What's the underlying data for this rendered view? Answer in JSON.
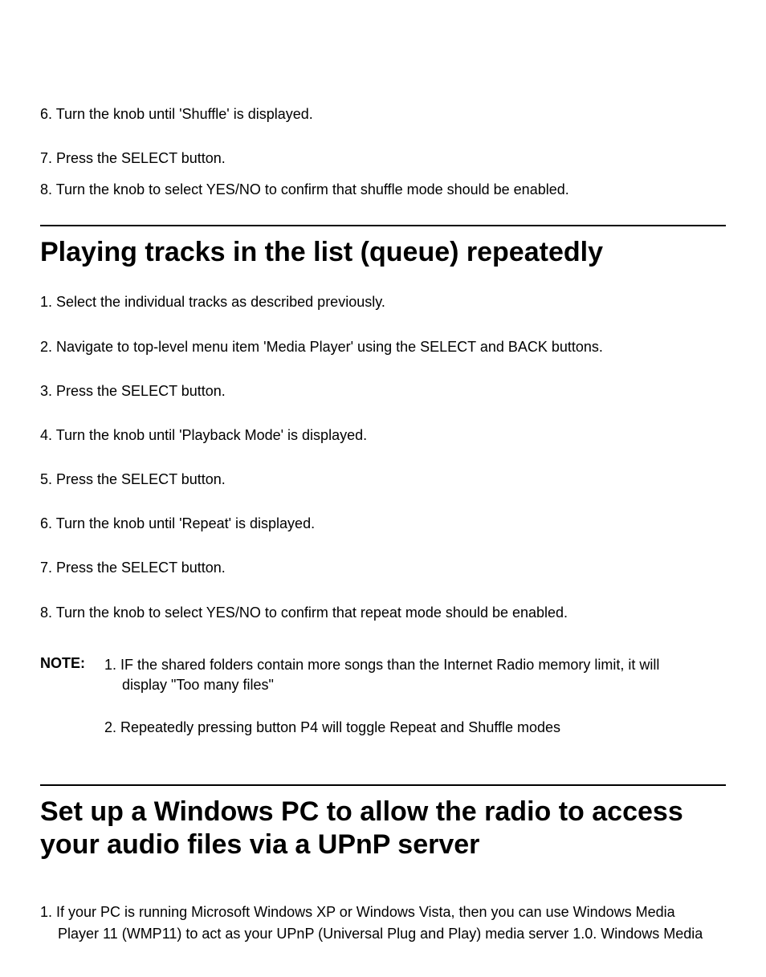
{
  "intro_steps": [
    "6. Turn the knob until 'Shuffle' is displayed.",
    "7. Press the SELECT button.",
    "8. Turn the knob to select YES/NO to confirm that shuffle mode should be enabled."
  ],
  "section1": {
    "heading": "Playing tracks in the list (queue) repeatedly",
    "steps": [
      "1. Select the individual tracks as described previously.",
      "2. Navigate to top-level menu item 'Media Player' using the SELECT and BACK buttons.",
      "3. Press the SELECT button.",
      "4. Turn the knob until 'Playback Mode' is displayed.",
      "5. Press the SELECT button.",
      "6. Turn the knob until 'Repeat' is displayed.",
      "7. Press the SELECT button.",
      "8. Turn the knob to select YES/NO to confirm that repeat mode should be enabled."
    ],
    "note_label": "NOTE:",
    "note_items": [
      {
        "first": "1. IF the shared folders contain more songs than the Internet Radio memory limit, it will",
        "cont": "display \"Too many files\""
      },
      {
        "first": "2. Repeatedly pressing button P4 will toggle Repeat and Shuffle modes",
        "cont": ""
      }
    ]
  },
  "section2": {
    "heading": "Set up a Windows PC to allow the radio to access your audio files via a UPnP server",
    "step1_line1": "1. If your PC is running Microsoft Windows XP or Windows Vista, then you can use Windows Media",
    "step1_line2": "Player 11 (WMP11) to act as your UPnP (Universal Plug and Play) media server 1.0. Windows Media"
  }
}
